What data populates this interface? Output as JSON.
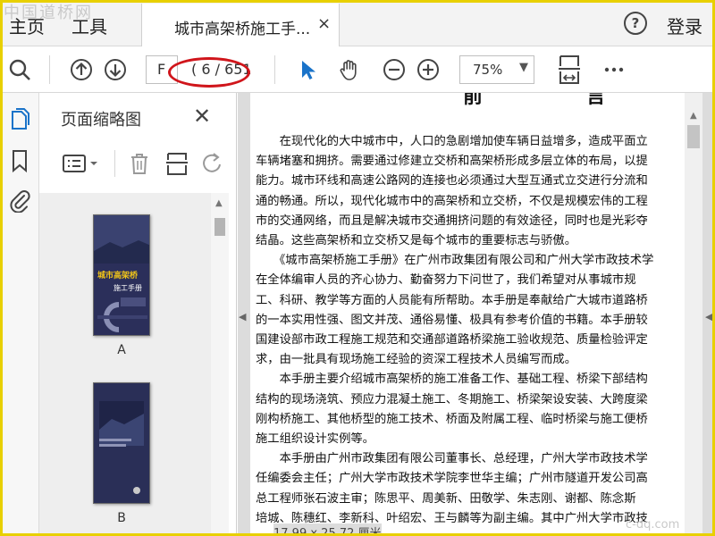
{
  "watermark": "中国道桥网",
  "url_watermark": "c-dq.com",
  "menu": {
    "home": "主页",
    "tools": "工具"
  },
  "tab": {
    "title": "城市高架桥施工手...",
    "close": "×"
  },
  "header": {
    "help": "?",
    "login": "登录"
  },
  "toolbar": {
    "page_input": "F",
    "page_count": "( 6 / 651",
    "zoom": "75%"
  },
  "panel": {
    "title": "页面缩略图",
    "close": "✕",
    "thumbnails": [
      {
        "label": "A"
      },
      {
        "label": "B"
      }
    ]
  },
  "document": {
    "heading": "前 言",
    "lines": [
      "　　在现代化的大中城市中，人口的急剧增加使车辆日益增多，造成平面立",
      "车辆堵塞和拥挤。需要通过修建立交桥和高架桥形成多层立体的布局，以提",
      "能力。城市环线和高速公路网的连接也必须通过大型互通式立交进行分流和",
      "通的畅通。所以，现代化城市中的高架桥和立交桥，不仅是规模宏伟的工程",
      "市的交通网络，而且是解决城市交通拥挤问题的有效途径，同时也是光彩夺",
      "结晶。这些高架桥和立交桥又是每个城市的重要标志与骄傲。",
      "　　《城市高架桥施工手册》在广州市政集团有限公司和广州大学市政技术学",
      "在全体编审人员的齐心协力、勤奋努力下问世了，我们希望对从事城市规",
      "工、科研、教学等方面的人员能有所帮助。本手册是奉献给广大城市道路桥",
      "的一本实用性强、图文并茂、通俗易懂、极具有参考价值的书籍。本手册较",
      "国建设部市政工程施工规范和交通部道路桥梁施工验收规范、质量检验评定",
      "求，由一批具有现场施工经验的资深工程技术人员编写而成。",
      "　　本手册主要介绍城市高架桥的施工准备工作、基础工程、桥梁下部结构",
      "结构的现场浇筑、预应力混凝土施工、冬期施工、桥梁架设安装、大跨度梁",
      "刚构桥施工、其他桥型的施工技术、桥面及附属工程、临时桥梁与施工便桥",
      "施工组织设计实例等。",
      "　　本手册由广州市政集团有限公司董事长、总经理，广州大学市政技术学",
      "任编委会主任；广州大学市政技术学院李世华主编；广州市隧道开发公司高",
      "总工程师张石波主审；陈思平、周美新、田敬学、朱志刚、谢都、陈念斯",
      "培城、陈穗红、李新科、叶绍宏、王与麟等为副主编。其中广州大学市政技"
    ],
    "page_size": "17.99 x 25.72 厘米"
  }
}
